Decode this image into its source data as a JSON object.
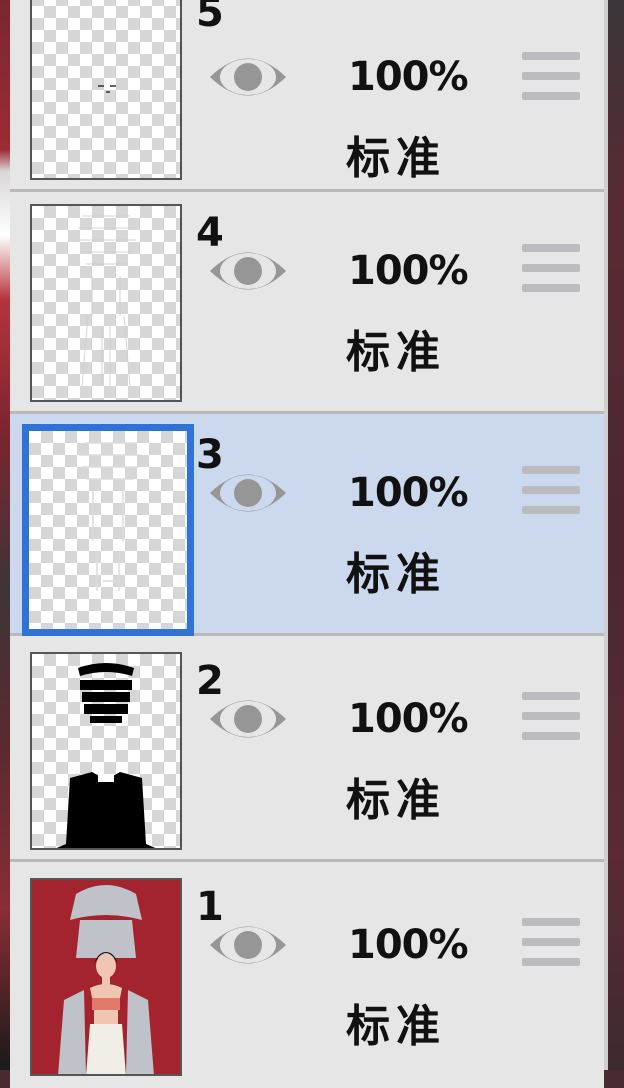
{
  "layers": [
    {
      "number": "5",
      "opacity": "100%",
      "blend": "标准"
    },
    {
      "number": "4",
      "opacity": "100%",
      "blend": "标准"
    },
    {
      "number": "3",
      "opacity": "100%",
      "blend": "标准",
      "selected": true
    },
    {
      "number": "2",
      "opacity": "100%",
      "blend": "标准"
    },
    {
      "number": "1",
      "opacity": "100%",
      "blend": "标准"
    }
  ],
  "icons": {
    "visibility": "eye-icon",
    "reorder": "drag-handle-icon"
  },
  "colors": {
    "selected_row": "#cbd8ee",
    "selected_border": "#2f73d6",
    "panel": "#e6e6e6"
  }
}
